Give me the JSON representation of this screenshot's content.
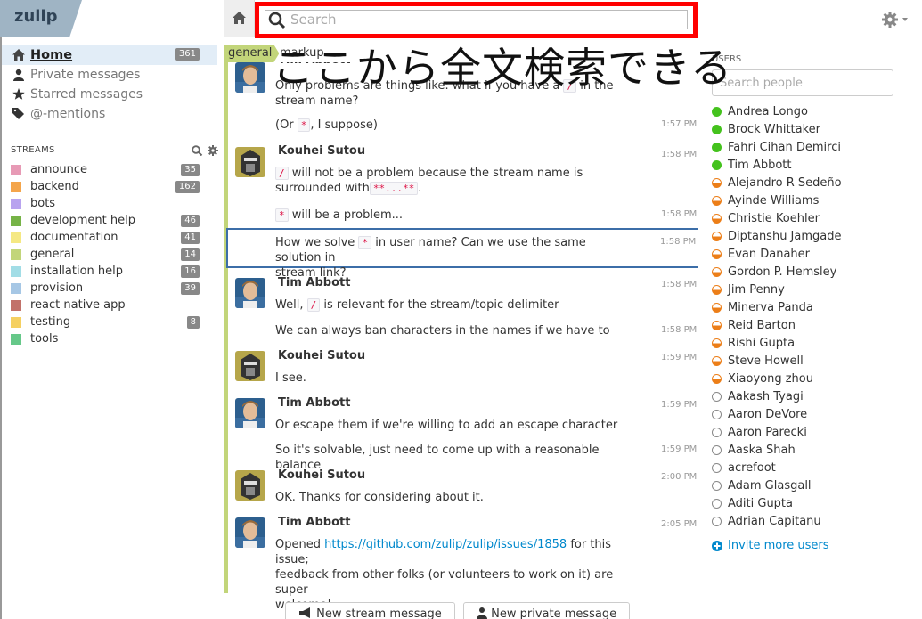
{
  "app": {
    "logo": "zulip"
  },
  "search": {
    "placeholder": "Search"
  },
  "annotation": {
    "text": "ここから全文検索できる"
  },
  "left_nav": [
    {
      "label": "Home",
      "count": "361",
      "icon": "home-icon",
      "active": true
    },
    {
      "label": "Private messages",
      "icon": "user-icon"
    },
    {
      "label": "Starred messages",
      "icon": "star-icon"
    },
    {
      "label": "@-mentions",
      "icon": "tag-icon"
    }
  ],
  "streams": {
    "header": "STREAMS",
    "items": [
      {
        "name": "announce",
        "count": "35",
        "color": "#e79ab5"
      },
      {
        "name": "backend",
        "count": "162",
        "color": "#f4a54b"
      },
      {
        "name": "bots",
        "count": "",
        "color": "#b8a3ef"
      },
      {
        "name": "development help",
        "count": "46",
        "color": "#76b347"
      },
      {
        "name": "documentation",
        "count": "41",
        "color": "#f5e883"
      },
      {
        "name": "general",
        "count": "14",
        "color": "#c2d57a"
      },
      {
        "name": "installation help",
        "count": "16",
        "color": "#a2dde6"
      },
      {
        "name": "provision",
        "count": "39",
        "color": "#a6c7e5"
      },
      {
        "name": "react native app",
        "count": "",
        "color": "#c2726a"
      },
      {
        "name": "testing",
        "count": "8",
        "color": "#f5d061"
      },
      {
        "name": "tools",
        "count": "",
        "color": "#66c889"
      }
    ]
  },
  "recipient": {
    "stream": "general",
    "topic": "markup"
  },
  "messages": [
    {
      "id": "m1",
      "sender": "Tim Abbott",
      "lines": [
        "Only problems are things like: what if you have a / in the",
        "stream name?"
      ],
      "time": ""
    },
    {
      "id": "m2",
      "sender": "",
      "text": "(Or * , I suppose)",
      "time": "1:57 PM"
    },
    {
      "id": "m3",
      "sender": "Kouhei Sutou",
      "time": "1:58 PM"
    },
    {
      "id": "m4",
      "sender": "",
      "time": "1:58 PM"
    },
    {
      "id": "m5",
      "sender": "",
      "time": "1:58 PM"
    },
    {
      "id": "m6",
      "sender": "Tim Abbott",
      "time": "1:58 PM"
    },
    {
      "id": "m7",
      "sender": "",
      "text": "We can always ban characters in the names if we have to",
      "time": "1:58 PM"
    },
    {
      "id": "m8",
      "sender": "Kouhei Sutou",
      "text": "I see.",
      "time": "1:59 PM"
    },
    {
      "id": "m9",
      "sender": "Tim Abbott",
      "text": "Or escape them if we're willing to add an escape character",
      "time": "1:59 PM"
    },
    {
      "id": "m10",
      "sender": "",
      "text": "So it's solvable, just need to come up with a reasonable balance",
      "time": "1:59 PM"
    },
    {
      "id": "m11",
      "sender": "Kouhei Sutou",
      "text": "OK. Thanks for considering about it.",
      "time": "2:00 PM"
    },
    {
      "id": "m12",
      "sender": "Tim Abbott",
      "time": "2:05 PM",
      "link": "https://github.com/zulip/zulip/issues/1858"
    }
  ],
  "msg_text": {
    "m1_l1a": "Only problems are things like: what if you have a",
    "m1_l1b": "in the",
    "m1_l2": "stream name?",
    "m2_a": "(Or",
    "m2_b": ", I suppose)",
    "m3_l1": "will not be a problem because the stream name is",
    "m3_l2": "surrounded with",
    "m3_code": "**...**",
    "m4": "will be a problem...",
    "m5_a": "How we solve",
    "m5_b": "in user name? Can we use the same solution in",
    "m5_l2": "stream link?",
    "m6_a": "Well,",
    "m6_b": "is relevant for the stream/topic delimiter",
    "m12_a": "Opened",
    "m12_b": "for this issue;",
    "m12_l2": "feedback from other folks (or volunteers to work on it) are super",
    "m12_l3": "welcome!",
    "slash": "/",
    "star": "*",
    "period": "."
  },
  "compose": {
    "new_stream": "New stream message",
    "new_private": "New private message"
  },
  "users": {
    "header": "USERS",
    "search_placeholder": "Search people",
    "list": [
      {
        "name": "Andrea Longo",
        "status": "active"
      },
      {
        "name": "Brock Whittaker",
        "status": "active"
      },
      {
        "name": "Fahri Cihan Demirci",
        "status": "active"
      },
      {
        "name": "Tim Abbott",
        "status": "active"
      },
      {
        "name": "Alejandro R Sedeño",
        "status": "idle"
      },
      {
        "name": "Ayinde Williams",
        "status": "idle"
      },
      {
        "name": "Christie Koehler",
        "status": "idle"
      },
      {
        "name": "Diptanshu Jamgade",
        "status": "idle"
      },
      {
        "name": "Evan Danaher",
        "status": "idle"
      },
      {
        "name": "Gordon P. Hemsley",
        "status": "idle"
      },
      {
        "name": "Jim Penny",
        "status": "idle"
      },
      {
        "name": "Minerva Panda",
        "status": "idle"
      },
      {
        "name": "Reid Barton",
        "status": "idle"
      },
      {
        "name": "Rishi Gupta",
        "status": "idle"
      },
      {
        "name": "Steve Howell",
        "status": "idle"
      },
      {
        "name": "Xiaoyong zhou",
        "status": "idle"
      },
      {
        "name": "Aakash Tyagi",
        "status": "offline"
      },
      {
        "name": "Aaron DeVore",
        "status": "offline"
      },
      {
        "name": "Aaron Parecki",
        "status": "offline"
      },
      {
        "name": "Aaska Shah",
        "status": "offline"
      },
      {
        "name": "acrefoot",
        "status": "offline"
      },
      {
        "name": "Adam Glasgall",
        "status": "offline"
      },
      {
        "name": "Aditi Gupta",
        "status": "offline"
      },
      {
        "name": "Adrian Capitanu",
        "status": "offline"
      }
    ],
    "invite": "Invite more users"
  }
}
